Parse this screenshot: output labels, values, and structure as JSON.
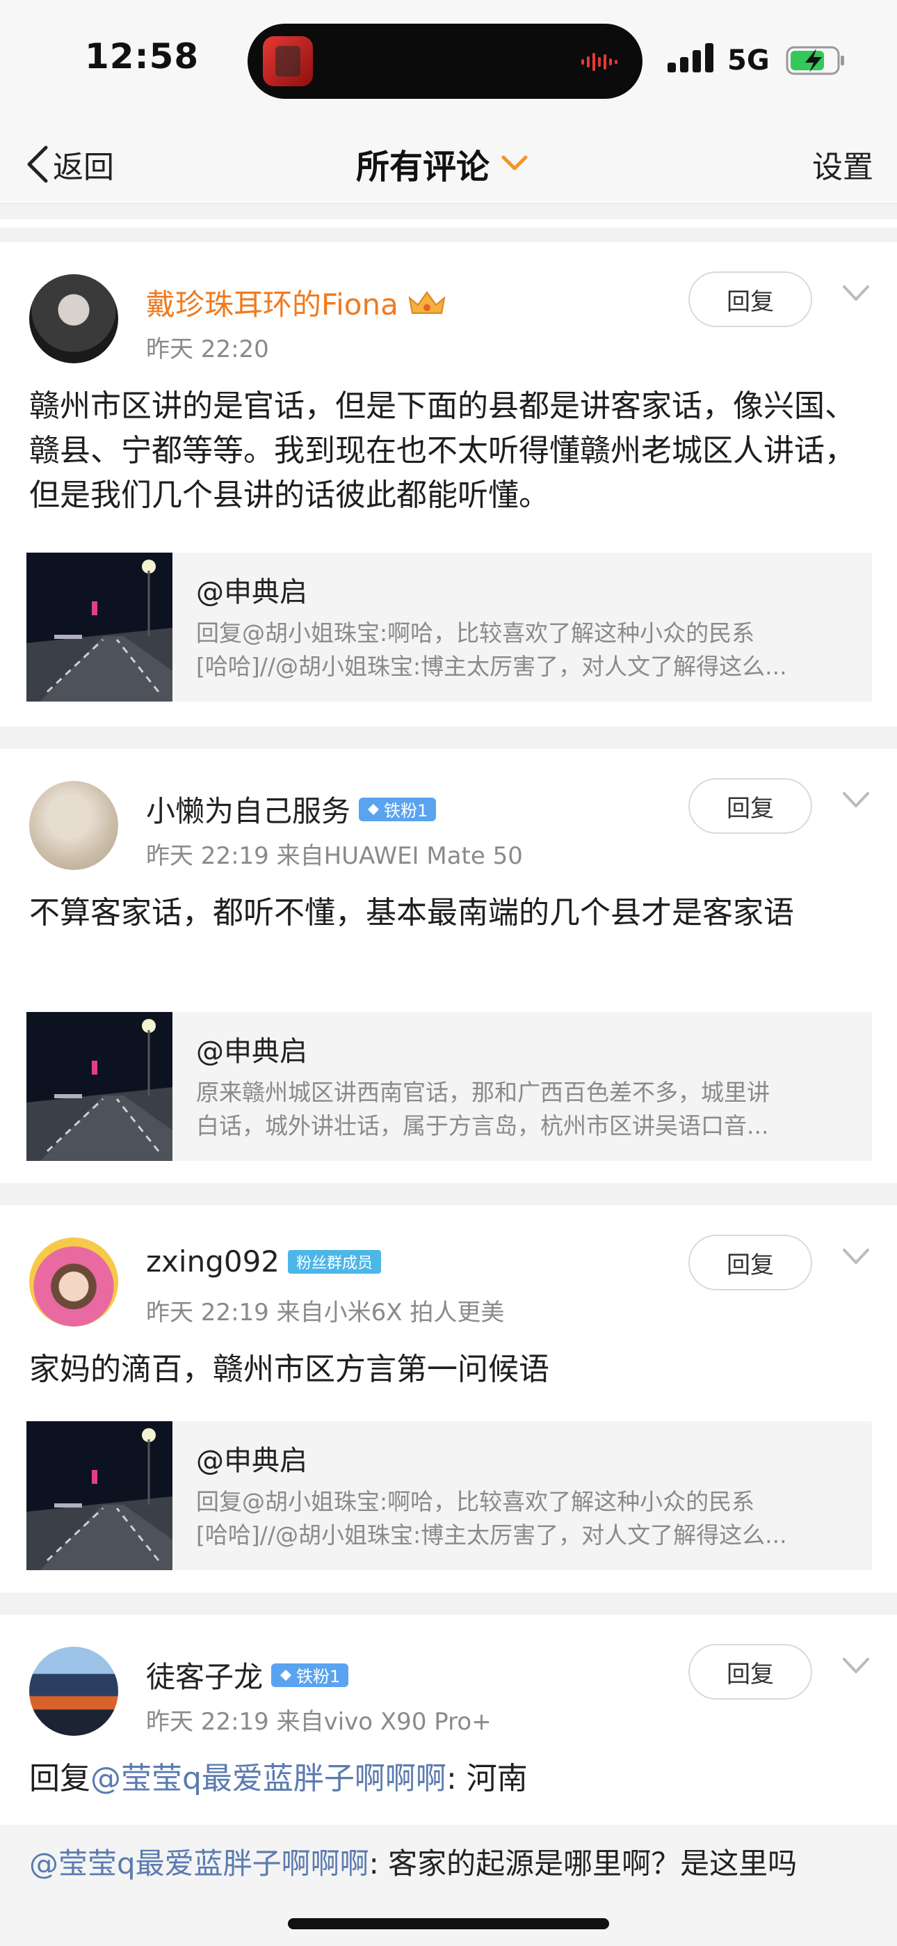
{
  "status_bar": {
    "time": "12:58",
    "network": "5G",
    "battery_color": "#34c759"
  },
  "nav": {
    "back_label": "返回",
    "title": "所有评论",
    "settings_label": "设置",
    "accent": "#f0952b"
  },
  "comments": [
    {
      "username": "戴珍珠耳环的Fiona",
      "username_color": "#f07a1f",
      "meta": "昨天 22:20",
      "reply_label": "回复",
      "content": "赣州市区讲的是官话，但是下面的县都是讲客家话，像兴国、赣县、宁都等等。我到现在也不太听得懂赣州老城区人讲话，但是我们几个县讲的话彼此都能听懂。",
      "quote": {
        "title": "@申典启",
        "line1": "回复@胡小姐珠宝:啊哈，比较喜欢了解这种小众的民系",
        "line2": "[哈哈]//@胡小姐珠宝:博主太厉害了，对人文了解得这么..."
      }
    },
    {
      "username": "小懒为自己服务",
      "badge": "铁粉1",
      "meta": "昨天 22:19   来自HUAWEI Mate 50",
      "reply_label": "回复",
      "content": "不算客家话，都听不懂，基本最南端的几个县才是客家语",
      "quote": {
        "title": "@申典启",
        "line1": "原来赣州城区讲西南官话，那和广西百色差不多，城里讲",
        "line2": "白话，城外讲壮话，属于方言岛，杭州市区讲吴语口音..."
      }
    },
    {
      "username": "zxing092",
      "badge": "粉丝群成员",
      "meta": "昨天 22:19   来自小米6X 拍人更美",
      "reply_label": "回复",
      "content": "家妈的滴百，赣州市区方言第一问候语",
      "quote": {
        "title": "@申典启",
        "line1": "回复@胡小姐珠宝:啊哈，比较喜欢了解这种小众的民系",
        "line2": "[哈哈]//@胡小姐珠宝:博主太厉害了，对人文了解得这么..."
      }
    },
    {
      "username": "徒客子龙",
      "badge": "铁粉1",
      "meta": "昨天 22:19   来自vivo X90 Pro+",
      "reply_label": "回复",
      "content_prefix": "回复",
      "content_mention": "@莹莹q最爱蓝胖子啊啊啊",
      "content_suffix": ": 河南"
    }
  ],
  "sub_reply": {
    "mention": "@莹莹q最爱蓝胖子啊啊啊",
    "text": ": 客家的起源是哪里啊？是这里吗"
  }
}
